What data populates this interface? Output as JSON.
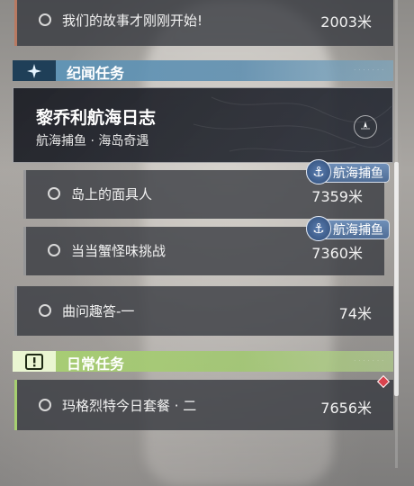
{
  "quests": {
    "top": {
      "name": "我们的故事才刚刚开始!",
      "distance": "2003米"
    },
    "featured": {
      "title": "黎乔利航海日志",
      "subtitle": "航海捕鱼 · 海岛奇遇"
    },
    "sub1": {
      "name": "岛上的面具人",
      "distance": "7359米",
      "badge": "航海捕鱼"
    },
    "sub2": {
      "name": "当当蟹怪味挑战",
      "distance": "7360米",
      "badge": "航海捕鱼"
    },
    "q3": {
      "name": "曲问趣答-一",
      "distance": "74米"
    },
    "daily1": {
      "name": "玛格烈特今日套餐 · 二",
      "distance": "7656米"
    }
  },
  "sections": {
    "story": {
      "label": "纪闻任务",
      "color": "#6fa7c6"
    },
    "daily": {
      "label": "日常任务",
      "color": "#a6cf70"
    }
  },
  "icons": {
    "story_icon": "sparkle-icon",
    "daily_icon": "exclamation-icon",
    "anchor": "anchor-icon",
    "track": "compass-icon",
    "marker": "diamond-marker-icon"
  }
}
